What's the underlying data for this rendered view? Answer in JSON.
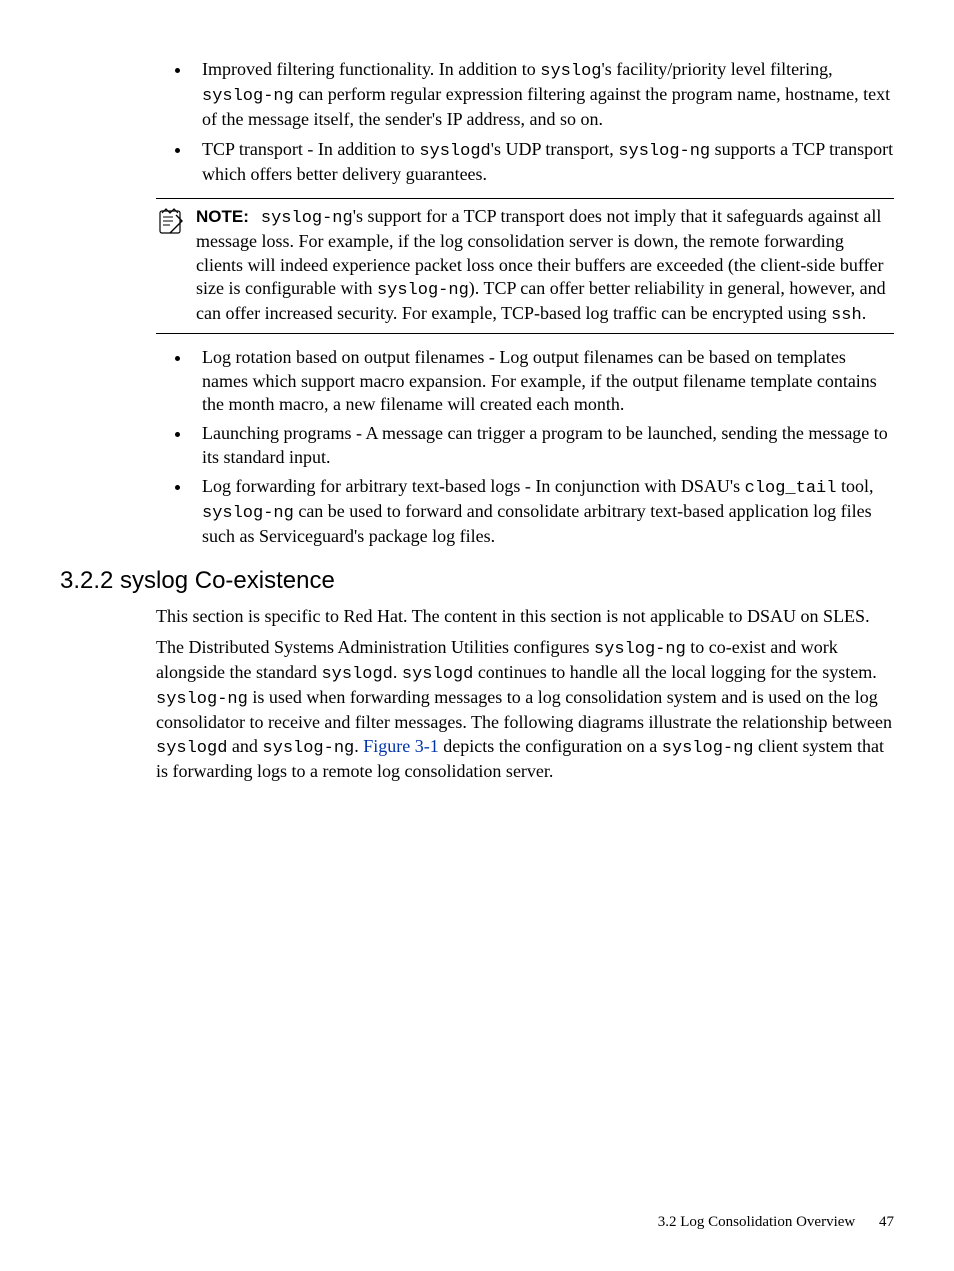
{
  "list1": {
    "items": [
      {
        "pre": "Improved filtering functionality. In addition to ",
        "code1": "syslog",
        "mid1": "'s facility/priority level filtering, ",
        "code2": "syslog-ng",
        "post": " can perform regular expression filtering against the program name, hostname, text of the message itself, the sender's IP address, and so on."
      },
      {
        "pre": "TCP transport - In addition to ",
        "code1": "syslogd",
        "mid1": "'s UDP transport, ",
        "code2": "syslog-ng",
        "post": " supports a TCP transport which offers better delivery guarantees."
      }
    ]
  },
  "note": {
    "label": "NOTE:",
    "code1": "syslog-ng",
    "text1": "'s support for a TCP transport does not imply that it safeguards against all message loss. For example, if the log consolidation server is down, the remote forwarding clients will indeed experience packet loss once their buffers are exceeded (the client-side buffer size is configurable with ",
    "code2": "syslog-ng",
    "text2": "). TCP can offer better reliability in general, however, and can offer increased security. For example, TCP-based log traffic can be encrypted using ",
    "code3": "ssh",
    "text3": "."
  },
  "list2": {
    "items": [
      {
        "text": "Log rotation based on output filenames - Log output filenames can be based on templates names which support macro expansion. For example, if the output filename template contains the month macro, a new filename will created each month."
      },
      {
        "text": "Launching programs - A message can trigger a program to be launched, sending the message to its standard input."
      },
      {
        "pre": "Log forwarding for arbitrary text-based logs - In conjunction with DSAU's ",
        "code1": "clog_tail",
        "mid1": " tool, ",
        "code2": "syslog-ng",
        "post": " can be used to forward and consolidate arbitrary text-based application log files such as Serviceguard's package log files."
      }
    ]
  },
  "heading": "3.2.2 syslog Co-existence",
  "para1": "This section is specific to Red Hat. The content in this section is not applicable to DSAU on SLES.",
  "para2": {
    "t1": "The Distributed Systems Administration Utilities configures ",
    "c1": "syslog-ng",
    "t2": " to co-exist and work alongside the standard ",
    "c2": "syslogd",
    "t3": ". ",
    "c3": "syslogd",
    "t4": " continues to handle all the local logging for the system. ",
    "c4": "syslog-ng",
    "t5": " is used when forwarding messages to a log consolidation system and is used on the log consolidator to receive and filter messages. The following diagrams illustrate the relationship between ",
    "c5": "syslogd",
    "t6": " and ",
    "c6": "syslog-ng",
    "t7": ". ",
    "figref": "Figure 3-1",
    "t8": " depicts the configuration on a ",
    "c7": "syslog-ng",
    "t9": " client system that is forwarding logs to a remote log consolidation server."
  },
  "footer": {
    "section": "3.2 Log Consolidation Overview",
    "page": "47"
  }
}
